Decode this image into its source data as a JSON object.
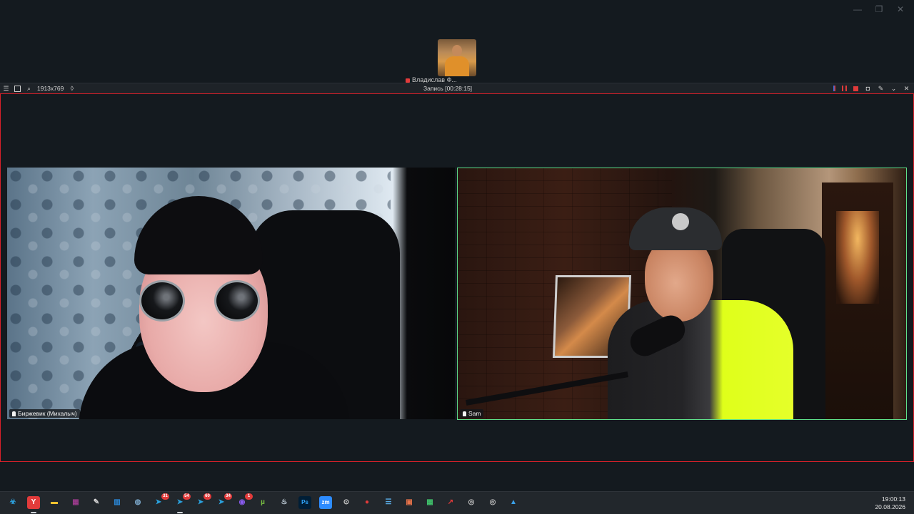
{
  "window_controls": {
    "minimize": "—",
    "maximize": "❐",
    "close": "✕"
  },
  "self_view": {
    "name": "Владислав Ф..."
  },
  "recorder": {
    "resolution": "1913x769",
    "title": "Запись [00:28:15]",
    "accent_color": "#e03a3a"
  },
  "tiles": [
    {
      "name": "Биржевик (Михалыч)"
    },
    {
      "name": "Sam",
      "border_color": "#5fe08a"
    }
  ],
  "taskbar": {
    "icons": [
      {
        "name": "start-icon",
        "glyph": "☣",
        "color": "#2ea8e8"
      },
      {
        "name": "yandex-browser-icon",
        "glyph": "Y",
        "color": "#ffffff"
      },
      {
        "name": "file-explorer-icon",
        "glyph": "▬",
        "color": "#f2c230"
      },
      {
        "name": "winrar-icon",
        "glyph": "▦",
        "color": "#9b3b8c"
      },
      {
        "name": "paint-icon",
        "glyph": "✎",
        "color": "#d9d9d9"
      },
      {
        "name": "calculator-icon",
        "glyph": "▥",
        "color": "#2b88d8"
      },
      {
        "name": "globe-icon",
        "glyph": "◍",
        "color": "#7aa6c8"
      },
      {
        "name": "telegram-icon-1",
        "glyph": "➤",
        "color": "#2aa3e0",
        "badge": "31"
      },
      {
        "name": "telegram-icon-2",
        "glyph": "➤",
        "color": "#2aa3e0",
        "badge": "54"
      },
      {
        "name": "telegram-icon-3",
        "glyph": "➤",
        "color": "#2aa3e0",
        "badge": "60"
      },
      {
        "name": "telegram-icon-4",
        "glyph": "➤",
        "color": "#2aa3e0",
        "badge": "34"
      },
      {
        "name": "chrome-icon",
        "glyph": "◉",
        "color": "#8a5cf0",
        "badge": "1"
      },
      {
        "name": "utorrent-icon",
        "glyph": "µ",
        "color": "#7ac142"
      },
      {
        "name": "steam-icon",
        "glyph": "♨",
        "color": "#c7d5e0"
      },
      {
        "name": "photoshop-icon",
        "glyph": "Ps",
        "color": "#31a8ff"
      },
      {
        "name": "zoom-icon",
        "glyph": "zm",
        "color": "#2d8cff"
      },
      {
        "name": "obs-icon",
        "glyph": "⊙",
        "color": "#d0d0d0"
      },
      {
        "name": "record-icon",
        "glyph": "●",
        "color": "#e03a3a"
      },
      {
        "name": "notes-icon",
        "glyph": "☰",
        "color": "#5aaee8"
      },
      {
        "name": "app-orange-icon",
        "glyph": "▣",
        "color": "#e8734a"
      },
      {
        "name": "sheets-icon",
        "glyph": "▦",
        "color": "#3fbf6a"
      },
      {
        "name": "arrow-app-icon",
        "glyph": "↗",
        "color": "#e03a3a"
      },
      {
        "name": "obs-studio-icon",
        "glyph": "◎",
        "color": "#c0c0c0",
        "badge": ""
      },
      {
        "name": "obs-studio-icon-2",
        "glyph": "◎",
        "color": "#c0c0c0"
      },
      {
        "name": "photos-icon",
        "glyph": "▲",
        "color": "#3aa0e8"
      }
    ],
    "time": "19:00:13",
    "date": "20.08.2026"
  }
}
